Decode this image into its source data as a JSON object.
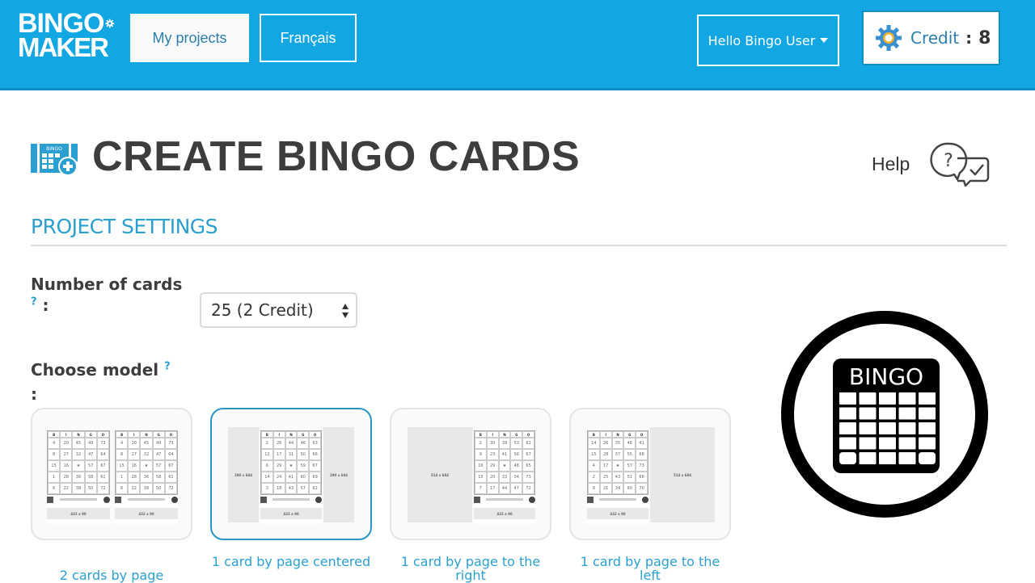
{
  "header": {
    "logo": {
      "line1": "BINGO",
      "line2": "MAKER"
    },
    "nav": {
      "my_projects": "My projects",
      "language": "Français"
    },
    "user_menu": "Hello Bingo User",
    "credit": {
      "label": "Credit",
      "separator": ":",
      "value": "8"
    },
    "colors": {
      "bar": "#12a6e3",
      "accent_text": "#2a7fae"
    }
  },
  "page": {
    "title": "CREATE BINGO CARDS",
    "help_label": "Help"
  },
  "section": {
    "title": "PROJECT SETTINGS"
  },
  "form": {
    "number_of_cards": {
      "label": "Number of cards",
      "help": "?",
      "colon": ":",
      "selected": "25 (2 Credit)"
    },
    "choose_model": {
      "label": "Choose model",
      "help": "?",
      "colon": ":"
    }
  },
  "models": [
    {
      "label": "2 cards by page",
      "selected": false,
      "cards": [
        {
          "header": [
            "B",
            "I",
            "N",
            "G",
            "O"
          ],
          "rows": [
            [
              "4",
              "20",
              "45",
              "49",
              "73"
            ],
            [
              "8",
              "27",
              "32",
              "47",
              "64"
            ],
            [
              "15",
              "16",
              "★",
              "57",
              "67"
            ],
            [
              "1",
              "28",
              "36",
              "58",
              "61"
            ],
            [
              "6",
              "22",
              "38",
              "50",
              "72"
            ]
          ],
          "banner": "432 x 90"
        },
        {
          "header": [
            "B",
            "I",
            "N",
            "G",
            "O"
          ],
          "rows": [
            [
              "4",
              "20",
              "45",
              "49",
              "73"
            ],
            [
              "8",
              "27",
              "32",
              "47",
              "64"
            ],
            [
              "15",
              "16",
              "★",
              "57",
              "67"
            ],
            [
              "1",
              "28",
              "36",
              "58",
              "61"
            ],
            [
              "6",
              "22",
              "38",
              "50",
              "72"
            ]
          ],
          "banner": "432 x 90"
        }
      ]
    },
    {
      "label": "1 card by page centered",
      "selected": true,
      "side_blocks": [
        "290 x 684",
        "290 x 684"
      ],
      "cards": [
        {
          "header": [
            "B",
            "I",
            "N",
            "G",
            "O"
          ],
          "rows": [
            [
              "2",
              "26",
              "44",
              "46",
              "63"
            ],
            [
              "12",
              "17",
              "31",
              "50",
              "66"
            ],
            [
              "6",
              "29",
              "★",
              "59",
              "67"
            ],
            [
              "14",
              "24",
              "41",
              "60",
              "69"
            ],
            [
              "3",
              "18",
              "43",
              "57",
              "62"
            ]
          ],
          "banner": "432 x 90"
        }
      ]
    },
    {
      "label": "1 card by page to the right",
      "selected": false,
      "side_blocks": [
        "514 x 684"
      ],
      "cards": [
        {
          "header": [
            "B",
            "I",
            "N",
            "G",
            "O"
          ],
          "rows": [
            [
              "2",
              "30",
              "39",
              "53",
              "62"
            ],
            [
              "9",
              "23",
              "41",
              "56",
              "67"
            ],
            [
              "16",
              "29",
              "★",
              "48",
              "65"
            ],
            [
              "13",
              "20",
              "33",
              "54",
              "73"
            ],
            [
              "7",
              "17",
              "44",
              "47",
              "72"
            ]
          ],
          "banner": "432 x 90"
        }
      ]
    },
    {
      "label": "1 card by page to the left",
      "selected": false,
      "side_blocks": [
        "514 x 684"
      ],
      "cards": [
        {
          "header": [
            "B",
            "I",
            "N",
            "G",
            "O"
          ],
          "rows": [
            [
              "14",
              "26",
              "35",
              "46",
              "41"
            ],
            [
              "15",
              "28",
              "37",
              "55",
              "68"
            ],
            [
              "4",
              "17",
              "★",
              "57",
              "73"
            ],
            [
              "2",
              "25",
              "43",
              "51",
              "66"
            ],
            [
              "9",
              "21",
              "34",
              "60",
              "70"
            ]
          ],
          "banner": "432 x 90"
        }
      ]
    }
  ],
  "emblem": {
    "text": "BINGO"
  }
}
